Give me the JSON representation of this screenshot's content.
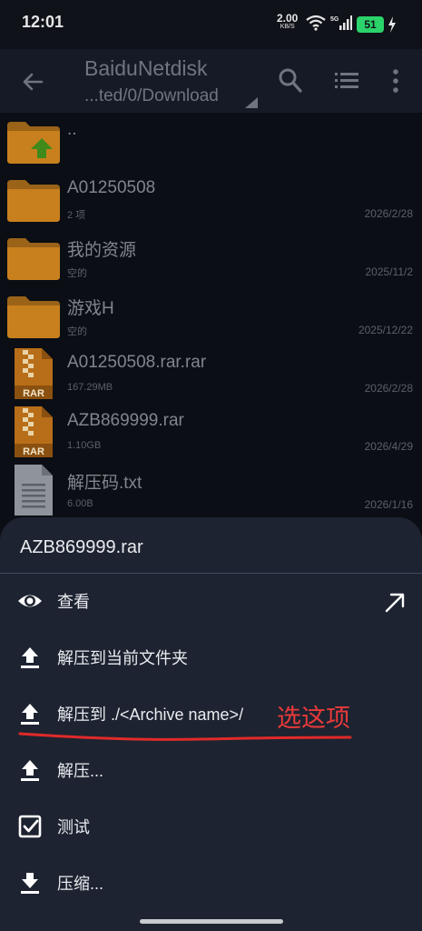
{
  "status_bar": {
    "time": "12:01",
    "net_speed_value": "2.00",
    "net_speed_unit": "KB/S",
    "network_type": "5G",
    "battery": "51"
  },
  "app_bar": {
    "title": "BaiduNetdisk",
    "path": "...ted/0/Download",
    "icons": [
      "back-arrow-icon",
      "search-icon",
      "list-view-icon",
      "more-vert-icon"
    ]
  },
  "files": [
    {
      "name": "..",
      "meta": "",
      "date": "",
      "type": "parent-folder"
    },
    {
      "name": "A01250508",
      "meta": "2 项",
      "date": "2026/2/28",
      "type": "folder"
    },
    {
      "name": "我的资源",
      "meta": "空的",
      "date": "2025/11/2",
      "type": "folder"
    },
    {
      "name": "游戏H",
      "meta": "空的",
      "date": "2025/12/22",
      "type": "folder"
    },
    {
      "name": "A01250508.rar.rar",
      "meta": "167.29MB",
      "date": "2026/2/28",
      "type": "rar",
      "icon_label": "RAR"
    },
    {
      "name": "AZB869999.rar",
      "meta": "1.10GB",
      "date": "2026/4/29",
      "type": "rar",
      "icon_label": "RAR"
    },
    {
      "name": "解压码.txt",
      "meta": "6.00B",
      "date": "2026/1/16",
      "type": "text"
    }
  ],
  "sheet": {
    "title": "AZB869999.rar",
    "items": [
      {
        "label": "查看",
        "icon": "eye-icon"
      },
      {
        "label": "解压到当前文件夹",
        "icon": "upload-icon"
      },
      {
        "label": "解压到 ./<Archive name>/",
        "icon": "upload-icon"
      },
      {
        "label": "解压...",
        "icon": "upload-icon"
      },
      {
        "label": "测试",
        "icon": "checkbox-icon"
      },
      {
        "label": "压缩...",
        "icon": "download-icon"
      }
    ],
    "annotation": "选这项"
  },
  "colors": {
    "folder": "#c8801e",
    "rar_body": "#b86e18",
    "annotation": "#e83a3a",
    "sheet_bg": "#1d2330"
  }
}
